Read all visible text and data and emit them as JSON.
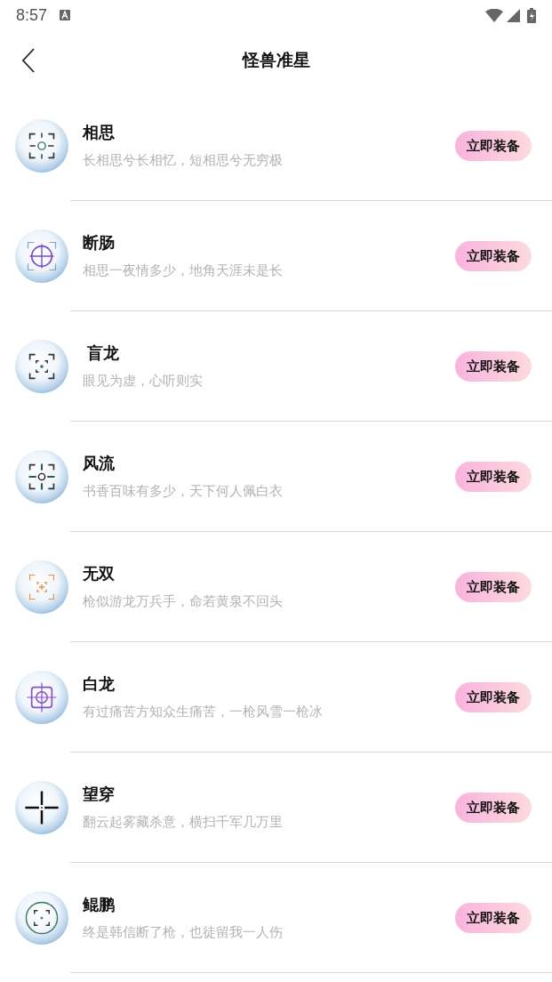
{
  "status_bar": {
    "time": "8:57"
  },
  "header": {
    "title": "怪兽准星"
  },
  "items": [
    {
      "name": "相思",
      "description": "长相思兮长相忆，短相思兮无穷极",
      "kind": "brackets-circle",
      "button": "立即装备"
    },
    {
      "name": "断肠",
      "description": "相思一夜情多少，地角天涯未是长",
      "kind": "circle-cross",
      "button": "立即装备"
    },
    {
      "name": " 盲龙",
      "description": "眼见为虚，心听则实",
      "kind": "brackets-dot",
      "button": "立即装备"
    },
    {
      "name": "风流",
      "description": "书香百味有多少，天下何人佩白衣",
      "kind": "brackets-arrows",
      "button": "立即装备"
    },
    {
      "name": "无双",
      "description": "枪似游龙万兵手，命若黄泉不回头",
      "kind": "brackets-plus",
      "button": "立即装备"
    },
    {
      "name": "白龙",
      "description": "有过痛苦方知众生痛苦，一枪风雪一枪冰",
      "kind": "square-target",
      "button": "立即装备"
    },
    {
      "name": "望穿",
      "description": "翻云起雾藏杀意，横扫千军几万里",
      "kind": "cross",
      "button": "立即装备"
    },
    {
      "name": "鲲鹏",
      "description": "终是韩信断了枪，也徒留我一人伤",
      "kind": "circle-brackets",
      "button": "立即装备"
    }
  ]
}
